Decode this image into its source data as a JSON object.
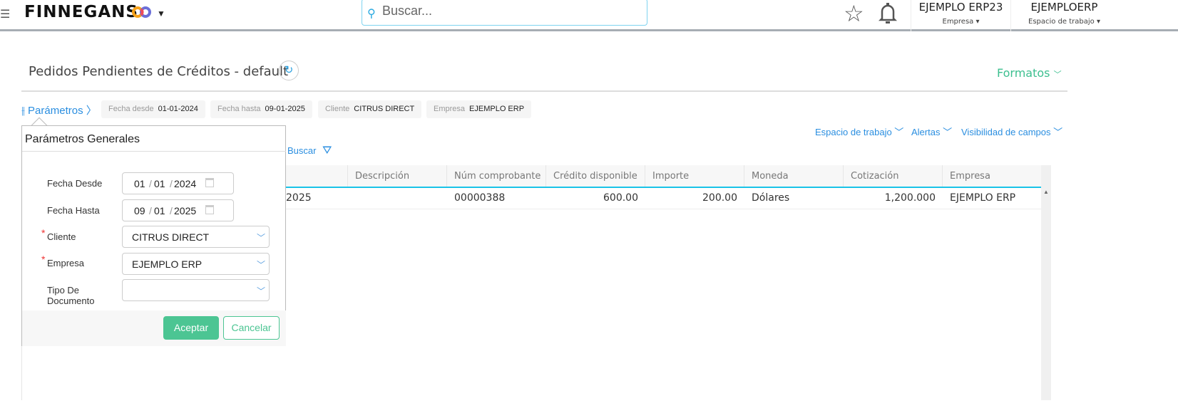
{
  "header": {
    "brand": "FINNEGANS",
    "search_placeholder": "Buscar...",
    "company": {
      "name": "EJEMPLO ERP23",
      "label": "Empresa"
    },
    "workspace": {
      "name": "EJEMPLOERP",
      "label": "Espacio de trabajo"
    }
  },
  "page": {
    "title": "Pedidos Pendientes de Créditos - default",
    "formatos": "Formatos"
  },
  "params": {
    "label": "Parámetros",
    "chips": [
      {
        "k": "Fecha desde",
        "v": "01-01-2024"
      },
      {
        "k": "Fecha hasta",
        "v": "09-01-2025"
      },
      {
        "k": "Cliente",
        "v": "CITRUS DIRECT"
      },
      {
        "k": "Empresa",
        "v": "EJEMPLO ERP"
      }
    ]
  },
  "toolbar": {
    "workspace": "Espacio de trabajo",
    "alerts": "Alertas",
    "visibility": "Visibilidad de campos",
    "search": "Buscar"
  },
  "table": {
    "columns": [
      "",
      "Descripción",
      "Núm comprobante",
      "Crédito disponible",
      "Importe",
      "Moneda",
      "Cotización",
      "Empresa"
    ],
    "rows": [
      [
        "2025",
        "",
        "00000388",
        "600.00",
        "200.00",
        "Dólares",
        "1,200.000",
        "EJEMPLO ERP"
      ]
    ]
  },
  "panel": {
    "title": "Parámetros Generales",
    "fecha_desde": {
      "label": "Fecha Desde",
      "d": "01",
      "m": "01",
      "y": "2024"
    },
    "fecha_hasta": {
      "label": "Fecha Hasta",
      "d": "09",
      "m": "01",
      "y": "2025"
    },
    "cliente": {
      "label": "Cliente",
      "value": "CITRUS DIRECT"
    },
    "empresa": {
      "label": "Empresa",
      "value": "EJEMPLO ERP"
    },
    "tipo": {
      "label": "Tipo De Documento",
      "value": ""
    },
    "accept": "Aceptar",
    "cancel": "Cancelar"
  }
}
